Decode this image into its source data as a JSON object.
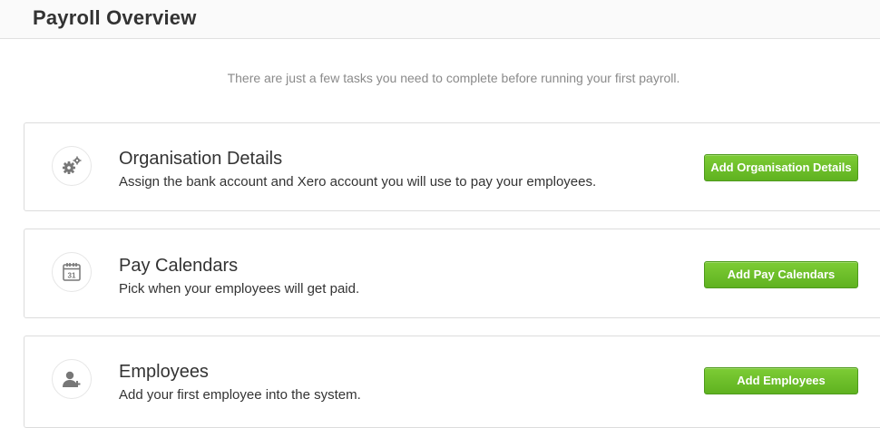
{
  "header": {
    "title": "Payroll Overview"
  },
  "intro": "There are just a few tasks you need to complete before running your first payroll.",
  "tasks": [
    {
      "icon": "gears-icon",
      "title": "Organisation Details",
      "description": "Assign the bank account and Xero account you will use to pay your employees.",
      "button_label": "Add Organisation Details"
    },
    {
      "icon": "calendar-icon",
      "calendar_day": "31",
      "title": "Pay Calendars",
      "description": "Pick when your employees will get paid.",
      "button_label": "Add Pay Calendars"
    },
    {
      "icon": "add-user-icon",
      "title": "Employees",
      "description": "Add your first employee into the system.",
      "button_label": "Add Employees"
    }
  ],
  "colors": {
    "button_green": "#6cc02a",
    "intro_text": "#8a8a8a",
    "card_border": "#dcdcdc"
  }
}
